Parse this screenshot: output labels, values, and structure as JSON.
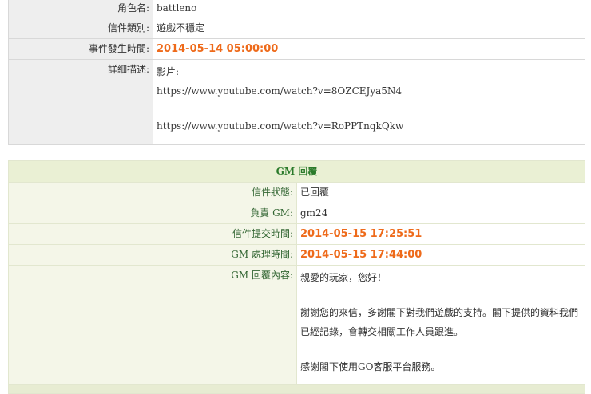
{
  "mail": {
    "rows": {
      "role_label": "角色名:",
      "role_value": "battleno",
      "type_label": "信件類別:",
      "type_value": "遊戲不穩定",
      "event_time_label": "事件發生時間:",
      "event_time_value": "2014-05-14 05:00:00",
      "detail_label": "詳細描述:",
      "detail_line1": "影片:",
      "detail_line2": "https://www.youtube.com/watch?v=8OZCEJya5N4",
      "detail_line3": "https://www.youtube.com/watch?v=RoPPTnqkQkw"
    }
  },
  "reply": {
    "header": "GM 回覆",
    "status_label": "信件狀態:",
    "status_value": "已回覆",
    "gm_label": "負責 GM:",
    "gm_value": "gm24",
    "submit_label": "信件提交時間:",
    "submit_value": "2014-05-15 17:25:51",
    "process_label": "GM 處理時間:",
    "process_value": "2014-05-15 17:44:00",
    "content_label": "GM 回覆內容:",
    "content_line1": "親愛的玩家，您好！",
    "content_line2": "謝謝您的來信，多謝閣下對我們遊戲的支持。閣下提供的資料我們已經記錄，會轉交相關工作人員跟進。",
    "content_line3": "感謝閣下使用GO客服平台服務。"
  }
}
